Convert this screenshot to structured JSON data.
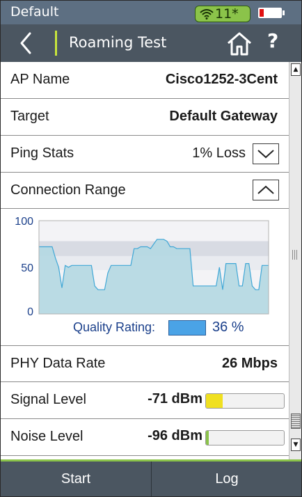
{
  "status_bar": {
    "profile": "Default",
    "wifi_count": "11*",
    "battery_level": 0.15,
    "battery_color": "#e01010",
    "wifi_badge_color": "#8bc34a"
  },
  "title_bar": {
    "title": "Roaming Test",
    "back_icon": "chevron-left-icon",
    "home_icon": "home-icon",
    "help_label": "?"
  },
  "rows": {
    "ap_name": {
      "label": "AP Name",
      "value": "Cisco1252-3Cent"
    },
    "target": {
      "label": "Target",
      "value": "Default Gateway"
    },
    "ping_stats": {
      "label": "Ping Stats",
      "value": "1% Loss"
    },
    "connection_range": {
      "label": "Connection Range"
    },
    "phy_data_rate": {
      "label": "PHY Data Rate",
      "value": "26 Mbps"
    },
    "signal_level": {
      "label": "Signal Level",
      "value": "-71 dBm",
      "bar_fraction": 0.21,
      "bar_color": "#f0e020"
    },
    "noise_level": {
      "label": "Noise Level",
      "value": "-96 dBm",
      "bar_fraction": 0.02,
      "bar_color": "#8bc34a"
    }
  },
  "quality": {
    "label": "Quality Rating:",
    "value": "36 %",
    "swatch_color": "#4aa3e6"
  },
  "chart_data": {
    "type": "area",
    "y_ticks": [
      "100",
      "50",
      "0"
    ],
    "ylim": [
      0,
      100
    ],
    "x": [
      0,
      1,
      2,
      3,
      4,
      5,
      6,
      7,
      8,
      9,
      10,
      11,
      12,
      13,
      14,
      15,
      16,
      17,
      18,
      19,
      20,
      21,
      22,
      23,
      24,
      25,
      26,
      27,
      28,
      29,
      30,
      31,
      32,
      33,
      34,
      35,
      36,
      37,
      38,
      39,
      40,
      41,
      42,
      43,
      44,
      45,
      46,
      47,
      48,
      49,
      50,
      51,
      52,
      53,
      54,
      55,
      56,
      57,
      58,
      59,
      60,
      61,
      62,
      63,
      64,
      65,
      66,
      67,
      68,
      69,
      70
    ],
    "values": [
      72,
      72,
      72,
      72,
      72,
      60,
      50,
      28,
      52,
      50,
      52,
      52,
      52,
      52,
      52,
      52,
      52,
      30,
      26,
      26,
      26,
      44,
      52,
      52,
      52,
      52,
      52,
      52,
      52,
      70,
      70,
      72,
      72,
      72,
      70,
      75,
      80,
      80,
      80,
      78,
      72,
      72,
      70,
      70,
      70,
      70,
      70,
      30,
      30,
      30,
      30,
      30,
      30,
      30,
      30,
      50,
      26,
      54,
      54,
      54,
      54,
      30,
      30,
      54,
      54,
      30,
      26,
      26,
      52,
      52,
      52
    ],
    "bands": [
      {
        "from": 62,
        "to": 78,
        "color": "#d8dbe3"
      },
      {
        "from": 47,
        "to": 62,
        "color": "#e9ebf0"
      }
    ],
    "fill_color": "#b4d8e2",
    "line_color": "#3fa7d6"
  }
}
